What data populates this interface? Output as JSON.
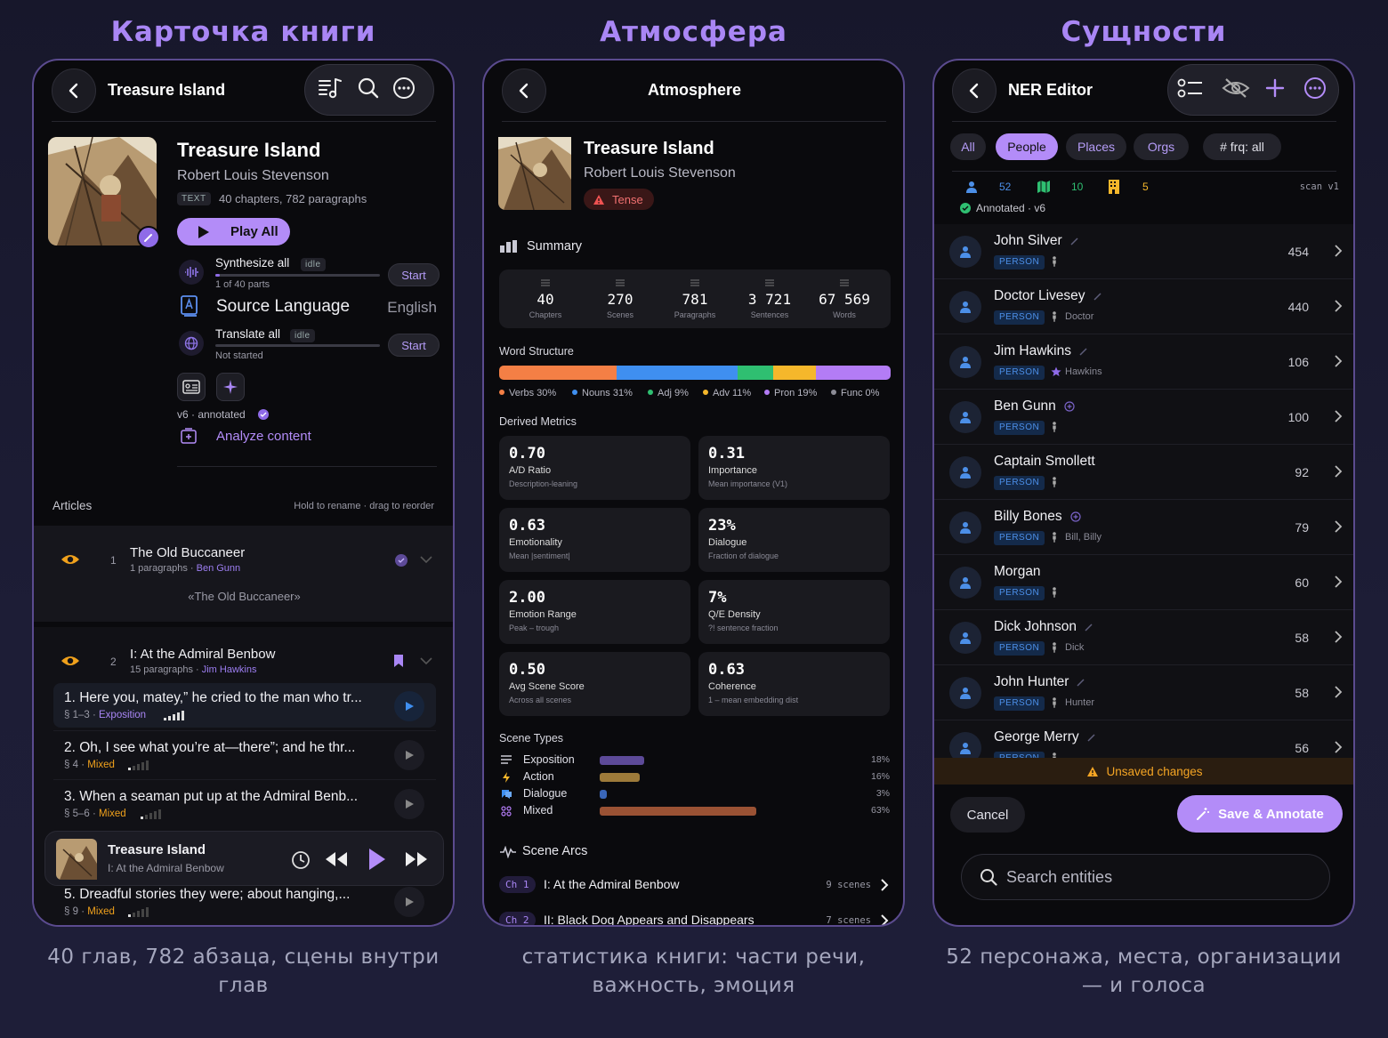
{
  "columns": [
    {
      "title": "Карточка книги",
      "caption": "40 глав, 782 абзаца, сцены внутри глав"
    },
    {
      "title": "Атмосфера",
      "caption": "статистика книги: части речи, важность, эмоция"
    },
    {
      "title": "Сущности",
      "caption": "52 персонажа, места, организации — и голоса"
    }
  ],
  "colors": {
    "accent": "#a986f5",
    "button": "#b38cf8",
    "person_badge": "#4c8fe8",
    "warning": "#f5a524"
  },
  "book": {
    "header_title": "Treasure Island",
    "title": "Treasure Island",
    "author": "Robert Louis Stevenson",
    "format_tag": "TEXT",
    "meta": "40 chapters, 782 paragraphs",
    "play_all": "Play All",
    "synthesize": {
      "label": "Synthesize all",
      "status": "idle",
      "progress": "1 of 40 parts",
      "progress_fraction": 0.025,
      "button": "Start"
    },
    "source_language": {
      "label": "Source Language",
      "value": "English"
    },
    "translate": {
      "label": "Translate all",
      "status": "idle",
      "progress": "Not started",
      "progress_fraction": 0,
      "button": "Start"
    },
    "version": "v6 · annotated",
    "analyze": "Analyze content",
    "articles_label": "Articles",
    "articles_hint": "Hold to rename · drag to reorder",
    "articles": [
      {
        "num": "1",
        "title": "The Old Buccaneer",
        "meta": "1 paragraphs",
        "person": "Ben Gunn",
        "preview": "«The Old Buccaneer»"
      },
      {
        "num": "2",
        "title": "I: At the Admiral Benbow",
        "meta": "15 paragraphs",
        "person": "Jim Hawkins"
      }
    ],
    "paragraphs": [
      {
        "text": "1. Here you, matey,” he cried to the man who tr...",
        "ref": "§ 1–3",
        "type": "Exposition"
      },
      {
        "text": "2. Oh, I see what you’re at—there”; and he thr...",
        "ref": "§ 4",
        "type": "Mixed"
      },
      {
        "text": "3. When a seaman put up at the Admiral Benb...",
        "ref": "§ 5–6",
        "type": "Mixed"
      },
      {
        "text": "5. Dreadful stories they were; about hanging,...",
        "ref": "§ 9",
        "type": "Mixed"
      }
    ],
    "player": {
      "title": "Treasure Island",
      "subtitle": "I: At the Admiral Benbow"
    }
  },
  "atmosphere": {
    "header_title": "Atmosphere",
    "book_title": "Treasure Island",
    "author": "Robert Louis Stevenson",
    "tone": "Tense",
    "summary_label": "Summary",
    "summary": [
      {
        "value": "40",
        "label": "Chapters"
      },
      {
        "value": "270",
        "label": "Scenes"
      },
      {
        "value": "781",
        "label": "Paragraphs"
      },
      {
        "value": "3 721",
        "label": "Sentences"
      },
      {
        "value": "67 569",
        "label": "Words"
      }
    ],
    "word_structure_label": "Word Structure",
    "word_structure": [
      {
        "label": "Verbs 30%",
        "fraction": 0.3,
        "color": "#f47f45"
      },
      {
        "label": "Nouns 31%",
        "fraction": 0.31,
        "color": "#3f8ff0"
      },
      {
        "label": "Adj 9%",
        "fraction": 0.09,
        "color": "#2fbf71"
      },
      {
        "label": "Adv 11%",
        "fraction": 0.11,
        "color": "#f5b72b"
      },
      {
        "label": "Pron 19%",
        "fraction": 0.19,
        "color": "#b37cf5"
      },
      {
        "label": "Func 0%",
        "fraction": 0.0,
        "color": "#8c8c96"
      }
    ],
    "derived_label": "Derived Metrics",
    "metrics": [
      {
        "value": "0.70",
        "label": "A/D Ratio",
        "sub": "Description-leaning"
      },
      {
        "value": "0.31",
        "label": "Importance",
        "sub": "Mean importance (V1)"
      },
      {
        "value": "0.63",
        "label": "Emotionality",
        "sub": "Mean |sentiment|"
      },
      {
        "value": "23%",
        "label": "Dialogue",
        "sub": "Fraction of dialogue"
      },
      {
        "value": "2.00",
        "label": "Emotion Range",
        "sub": "Peak – trough"
      },
      {
        "value": "7%",
        "label": "Q/E Density",
        "sub": "?! sentence fraction"
      },
      {
        "value": "0.50",
        "label": "Avg Scene Score",
        "sub": "Across all scenes"
      },
      {
        "value": "0.63",
        "label": "Coherence",
        "sub": "1 – mean embedding dist"
      }
    ],
    "scene_types_label": "Scene Types",
    "scene_types": [
      {
        "label": "Exposition",
        "pct": "18%",
        "fraction": 0.18,
        "color": "#5d4a98"
      },
      {
        "label": "Action",
        "pct": "16%",
        "fraction": 0.16,
        "color": "#9d7a3a"
      },
      {
        "label": "Dialogue",
        "pct": "3%",
        "fraction": 0.03,
        "color": "#3a66b8"
      },
      {
        "label": "Mixed",
        "pct": "63%",
        "fraction": 0.63,
        "color": "#9a5234"
      }
    ],
    "arcs_label": "Scene Arcs",
    "arcs": [
      {
        "ch": "Ch 1",
        "title": "I: At the Admiral Benbow",
        "scenes": "9 scenes"
      },
      {
        "ch": "Ch 2",
        "title": "II: Black Dog Appears and Disappears",
        "scenes": "7 scenes"
      }
    ]
  },
  "ner": {
    "header_title": "NER Editor",
    "filters": [
      "All",
      "People",
      "Places",
      "Orgs"
    ],
    "active_filter": "People",
    "freq_filter": "# frq: all",
    "counts": {
      "people": "52",
      "places": "10",
      "orgs": "5"
    },
    "scan": "scan v1",
    "annotated": "Annotated · v6",
    "entities": [
      {
        "name": "John Silver",
        "badge": "PERSON",
        "alias": "",
        "count": "454",
        "mark": "edit"
      },
      {
        "name": "Doctor Livesey",
        "badge": "PERSON",
        "alias": "Doctor",
        "count": "440",
        "mark": "edit"
      },
      {
        "name": "Jim Hawkins",
        "badge": "PERSON",
        "alias": "Hawkins",
        "count": "106",
        "mark": "edit"
      },
      {
        "name": "Ben Gunn",
        "badge": "PERSON",
        "alias": "",
        "count": "100",
        "mark": "add"
      },
      {
        "name": "Captain Smollett",
        "badge": "PERSON",
        "alias": "",
        "count": "92",
        "mark": ""
      },
      {
        "name": "Billy Bones",
        "badge": "PERSON",
        "alias": "Bill, Billy",
        "count": "79",
        "mark": "add"
      },
      {
        "name": "Morgan",
        "badge": "PERSON",
        "alias": "",
        "count": "60",
        "mark": ""
      },
      {
        "name": "Dick Johnson",
        "badge": "PERSON",
        "alias": "Dick",
        "count": "58",
        "mark": "edit"
      },
      {
        "name": "John Hunter",
        "badge": "PERSON",
        "alias": "Hunter",
        "count": "58",
        "mark": "edit"
      },
      {
        "name": "George Merry",
        "badge": "PERSON",
        "alias": "",
        "count": "56",
        "mark": "edit"
      }
    ],
    "unsaved": "Unsaved changes",
    "cancel": "Cancel",
    "save": "Save & Annotate",
    "search_placeholder": "Search entities"
  }
}
